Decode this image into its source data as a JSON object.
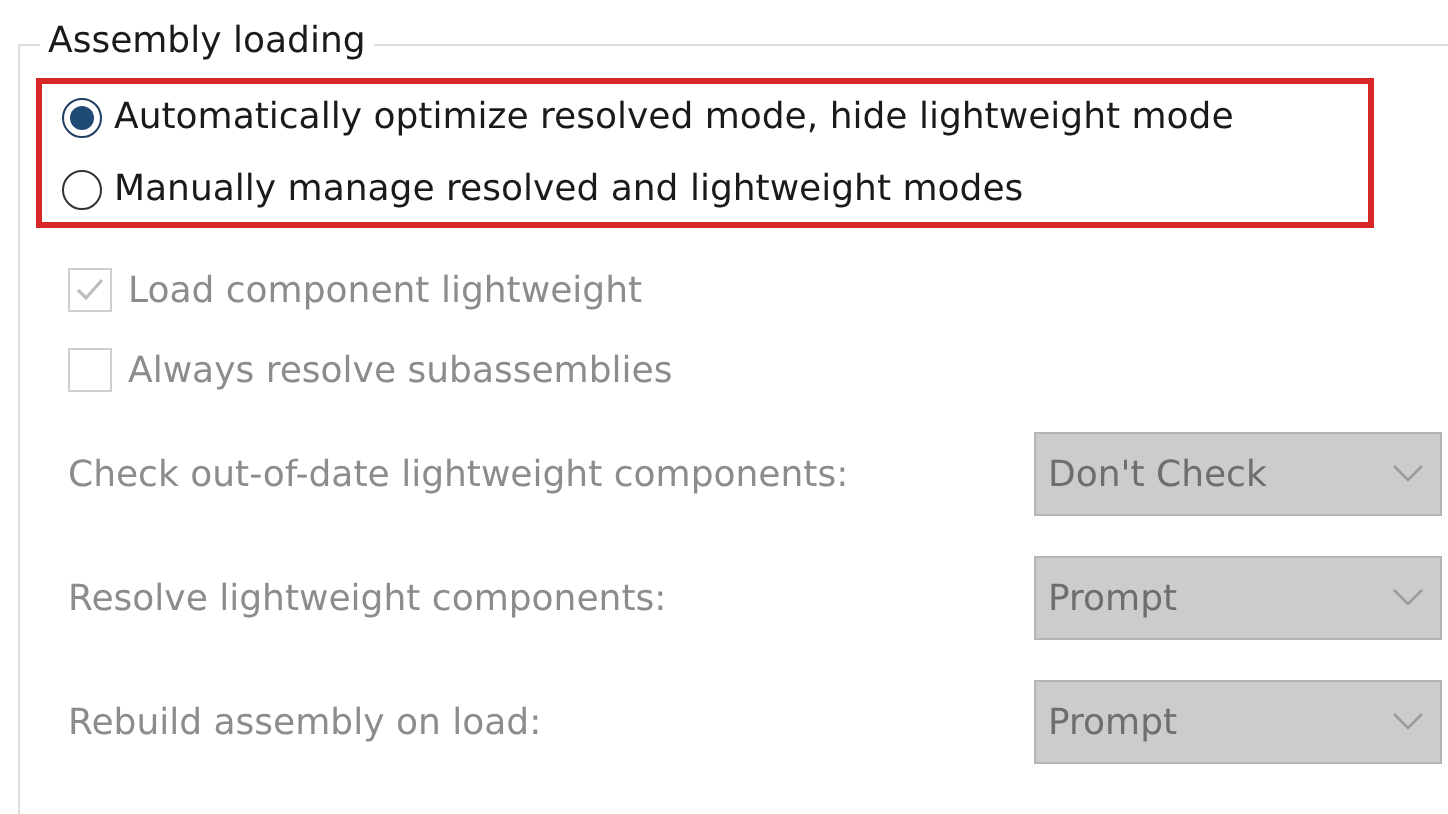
{
  "group": {
    "title": "Assembly loading"
  },
  "radio_group": {
    "highlighted": true,
    "options": [
      {
        "label": "Automatically optimize resolved mode, hide lightweight mode",
        "selected": true
      },
      {
        "label": "Manually manage resolved and lightweight modes",
        "selected": false
      }
    ]
  },
  "checkboxes": [
    {
      "label": "Load component lightweight",
      "checked": true,
      "disabled": true
    },
    {
      "label": "Always resolve subassemblies",
      "checked": false,
      "disabled": true
    }
  ],
  "dropdowns": [
    {
      "label": "Check out-of-date lightweight components:",
      "value": "Don't Check",
      "disabled": true
    },
    {
      "label": "Resolve lightweight components:",
      "value": "Prompt",
      "disabled": true
    },
    {
      "label": "Rebuild assembly on load:",
      "value": "Prompt",
      "disabled": true
    }
  ]
}
